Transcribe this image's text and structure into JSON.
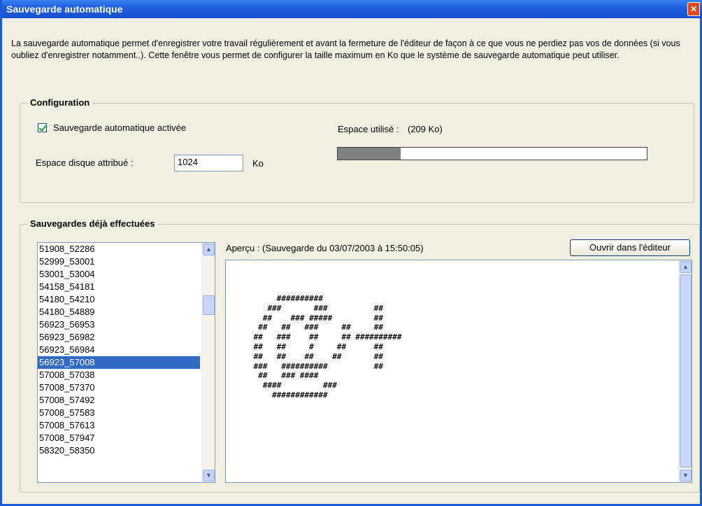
{
  "window": {
    "title": "Sauvegarde automatique",
    "close_label": "✕"
  },
  "description": "La sauvegarde automatique permet d'enregistrer votre travail régulièrement et avant la fermeture de l'éditeur de façon à ce que vous ne perdiez pas vos de données (si vous oubliez d'enregistrer notamment..). Cette fenêtre vous permet de configurer la taille maximum en Ko que le système de sauvegarde automatique peut utiliser.",
  "configuration": {
    "title": "Configuration",
    "autosave_label": "Sauvegarde automatique activée",
    "autosave_checked": true,
    "disk_space_label": "Espace disque attribué :",
    "disk_space_value": "1024",
    "disk_space_unit": "Ko",
    "used_space_label": "Espace utilisé :",
    "used_space_value": "(209 Ko)",
    "used_fraction": 0.2041
  },
  "saves": {
    "title": "Sauvegardes déjà effectuées",
    "items": [
      "51908_52286",
      "52999_53001",
      "53001_53004",
      "54158_54181",
      "54180_54210",
      "54180_54889",
      "56923_56953",
      "56923_56982",
      "56923_56984",
      "56923_57008",
      "57008_57038",
      "57008_57370",
      "57008_57492",
      "57008_57583",
      "57008_57613",
      "57008_57947",
      "58320_58350"
    ],
    "selected_index": 9,
    "preview_label": "Aperçu : (Sauvegarde du 03/07/2003 à 15:50:05)",
    "open_button": "Ouvrir dans l'éditeur",
    "preview_text": "      ##########\n    ###       ###          ##\n   ##    ### #####         ##\n  ##   ##   ###     ##     ##\n ##   ###    ##     ## ##########\n ##   ##     #     ##      ##\n ##   ##    ##    ##       ##\n ###   ##########          ##\n  ##   ### ####\n   ####         ###\n     ############"
  },
  "icons": {
    "check": "check-icon",
    "scroll_up": "▲",
    "scroll_down": "▼"
  }
}
